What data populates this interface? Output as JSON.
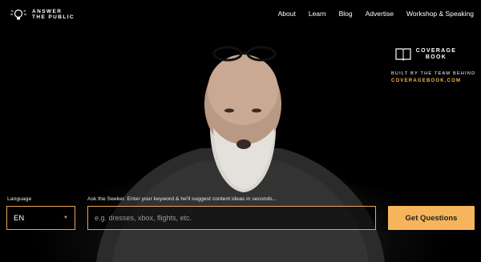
{
  "brand": {
    "line1": "ANSWER",
    "line2": "THE PUBLIC"
  },
  "nav": [
    {
      "label": "About"
    },
    {
      "label": "Learn"
    },
    {
      "label": "Blog"
    },
    {
      "label": "Advertise"
    },
    {
      "label": "Workshop & Speaking"
    }
  ],
  "promo": {
    "brand_line1": "COVERAGE",
    "brand_line2": "BOOK",
    "built_by": "BUILT BY THE TEAM BEHIND",
    "link": "COVERAGEBOOK.COM",
    "link_color": "#f5b74f"
  },
  "form": {
    "language_label": "Language",
    "language_value": "EN",
    "seeker_label": "Ask the Seeker. Enter your keyword & he'll suggest content ideas in seconds...",
    "search_placeholder": "e.g. dresses, xbox, flights, etc.",
    "submit_label": "Get Questions",
    "accent_color": "#f7b55b",
    "border_color": "#e3a55a"
  }
}
